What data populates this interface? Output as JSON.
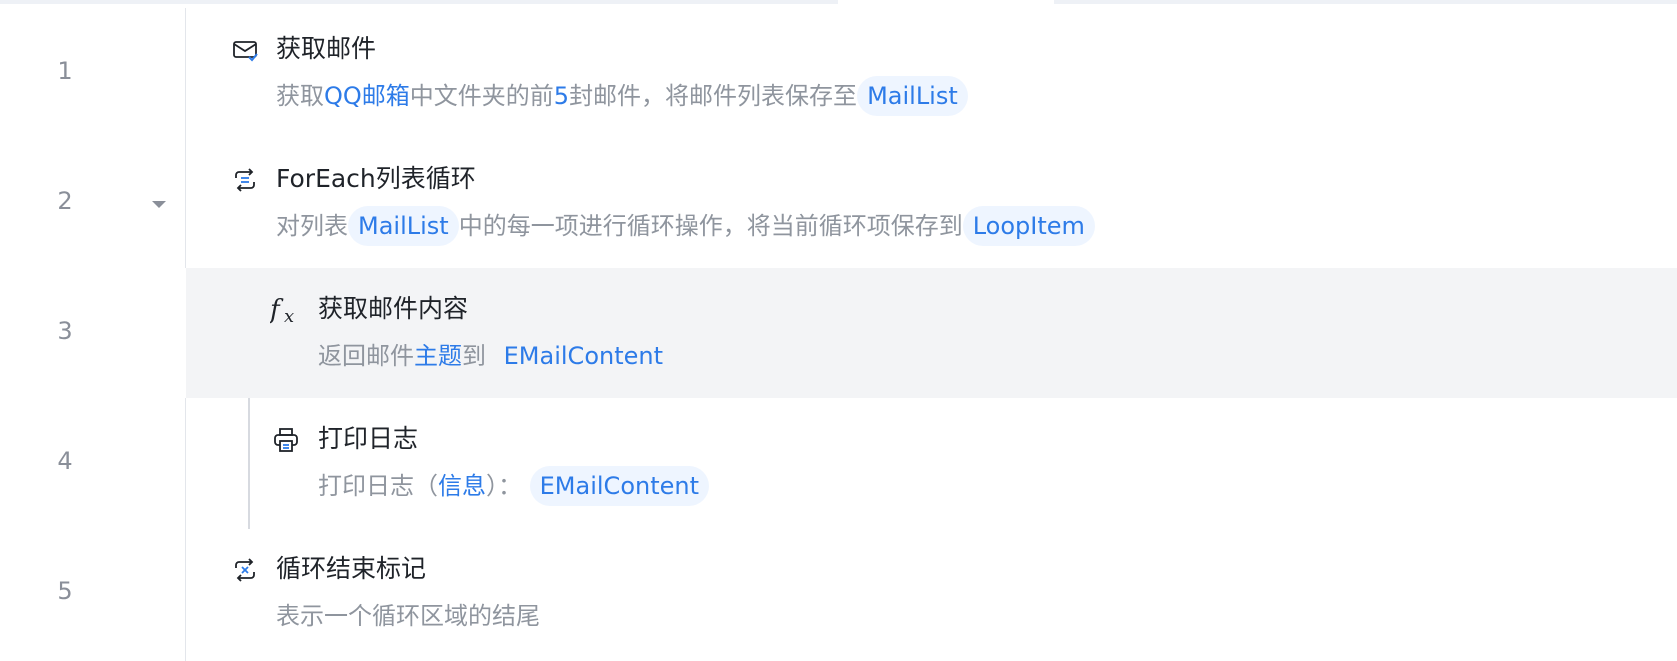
{
  "steps": [
    {
      "num": "1",
      "icon": "mail-check-icon",
      "title": "获取邮件",
      "desc": {
        "p1": "获取",
        "k1": "QQ邮箱",
        "p2": "中文件夹的前",
        "k2": "5",
        "p3": "封邮件，将邮件列表保存至",
        "tag": "MailList"
      }
    },
    {
      "num": "2",
      "icon": "loop-list-icon",
      "title": "ForEach列表循环",
      "desc": {
        "p1": "对列表",
        "tag1": "MailList",
        "p2": "中的每一项进行循环操作，将当前循环项保存到",
        "tag2": "LoopItem"
      }
    },
    {
      "num": "3",
      "icon": "function-icon",
      "title": "获取邮件内容",
      "desc": {
        "p1": "返回邮件",
        "k1": "主题",
        "p2": "到",
        "tag": "EMailContent"
      }
    },
    {
      "num": "4",
      "icon": "printer-icon",
      "title": "打印日志",
      "desc": {
        "p1": "打印日志（",
        "k1": "信息",
        "p2": "）：",
        "tag": "EMailContent"
      }
    },
    {
      "num": "5",
      "icon": "loop-end-icon",
      "title": "循环结束标记",
      "desc": {
        "p1": "表示一个循环区域的结尾"
      }
    }
  ],
  "colors": {
    "keyword": "#2d7be8",
    "tag_bg": "#eef5ff",
    "highlight_row": "#f3f4f6"
  }
}
